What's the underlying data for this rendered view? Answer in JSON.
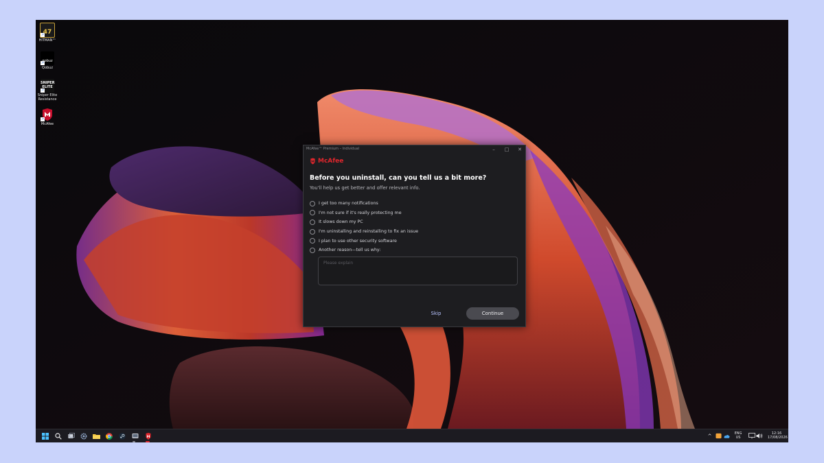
{
  "desktop": {
    "icons": [
      {
        "label": "HITMAN™",
        "icon": "hitman-game-icon",
        "glyph": "47"
      },
      {
        "label": "Qobuz",
        "icon": "qobuz-app-icon",
        "glyph": "qobuz"
      },
      {
        "label": "Sniper Elite\nResistance",
        "icon": "sniper-elite-game-icon",
        "glyph": "SNIPER ELITE"
      },
      {
        "label": "McAfee",
        "icon": "mcafee-shield-icon",
        "glyph": ""
      }
    ]
  },
  "dialog": {
    "window_title": "McAfee™ Premium – Individual",
    "brand": "McAfee",
    "heading": "Before you uninstall, can you tell us a bit more?",
    "subheading": "You'll help us get better and offer relevant info.",
    "options": [
      "I get too many notifications",
      "I'm not sure if it's really protecting me",
      "It slows down my PC",
      "I'm uninstalling and reinstalling to fix an issue",
      "I plan to use other security software",
      "Another reason—tell us why:"
    ],
    "explain_placeholder": "Please explain",
    "skip_label": "Skip",
    "continue_label": "Continue",
    "brand_color": "#e0262c"
  },
  "taskbar": {
    "pinned": [
      "windows-start-icon",
      "search-icon",
      "task-view-icon",
      "settings-icon",
      "file-explorer-icon",
      "chrome-icon",
      "steam-icon",
      "app-icon",
      "mcafee-taskbar-icon"
    ],
    "language": "ENG",
    "region": "US",
    "time": "12:16",
    "date": "17/08/2026"
  }
}
